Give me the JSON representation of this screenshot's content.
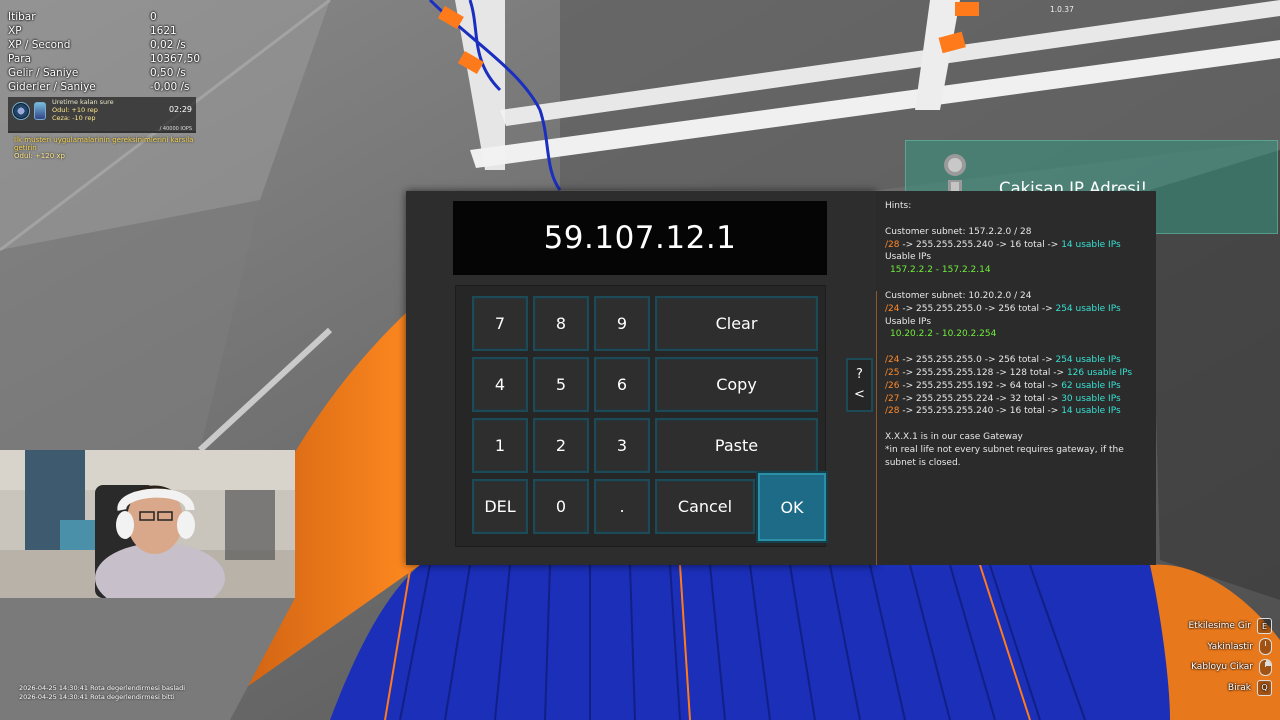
{
  "stats": [
    {
      "label": "Itibar",
      "value": "0"
    },
    {
      "label": "XP",
      "value": "1621"
    },
    {
      "label": "XP / Second",
      "value": "0,02 /s"
    },
    {
      "label": "Para",
      "value": "10367,50"
    },
    {
      "label": "Gelir / Saniye",
      "value": "0,50 /s"
    },
    {
      "label": "Giderler / Saniye",
      "value": "-0,00 /s"
    }
  ],
  "quest": {
    "title": "Uretime kalan sure",
    "reward": "Odul: +10 rep",
    "penalty": "Ceza: -10 rep",
    "timer": "02:29",
    "progress_text": "/ 40000 IOPS",
    "progress_fraction": 0.0
  },
  "customer_task": {
    "text": "Ilk musteri uygulamalarinin gereksinimlerini karsila getirin",
    "reward": "Odul: +120 xp"
  },
  "version": "1.0.37",
  "notification": {
    "title": "Cakisan IP Adresi!",
    "icon": "info-icon"
  },
  "keypad": {
    "display_value": "59.107.12.1",
    "keys": {
      "k7": "7",
      "k8": "8",
      "k9": "9",
      "clear": "Clear",
      "k4": "4",
      "k5": "5",
      "k6": "6",
      "copy": "Copy",
      "k1": "1",
      "k2": "2",
      "k3": "3",
      "paste": "Paste",
      "del": "DEL",
      "k0": "0",
      "dot": ".",
      "cancel": "Cancel",
      "ok": "OK"
    },
    "side_toggle": {
      "help": "?",
      "back": "<"
    }
  },
  "hints": {
    "title": "Hints:",
    "customer1": {
      "subnet": "Customer subnet: 157.2.2.0 / 28",
      "mask": "/28",
      "mask_rest": " -> 255.255.255.240  ->  16 total  -> ",
      "usable": "14 usable IPs",
      "usable_label": "Usable IPs",
      "range": "157.2.2.2 - 157.2.2.14"
    },
    "customer2": {
      "subnet": "Customer subnet: 10.20.2.0 / 24",
      "mask": "/24",
      "mask_rest": " -> 255.255.255.0  ->  256 total  -> ",
      "usable": "254 usable IPs",
      "usable_label": "Usable IPs",
      "range": "10.20.2.2 - 10.20.2.254"
    },
    "table": [
      {
        "mask": "/24",
        "rest": " -> 255.255.255.0  ->  256 total  -> ",
        "usable": "254 usable IPs"
      },
      {
        "mask": "/25",
        "rest": " -> 255.255.255.128  ->  128 total  -> ",
        "usable": "126 usable IPs"
      },
      {
        "mask": "/26",
        "rest": " -> 255.255.255.192  ->  64 total  -> ",
        "usable": "62 usable IPs"
      },
      {
        "mask": "/27",
        "rest": " -> 255.255.255.224  ->  32 total  -> ",
        "usable": "30 usable IPs"
      },
      {
        "mask": "/28",
        "rest": " -> 255.255.255.240  ->  16 total  -> ",
        "usable": "14 usable IPs"
      }
    ],
    "gateway_line": "X.X.X.1 is in our case Gateway",
    "gateway_note": " *in real life not every subnet requires gateway, if the subnet is closed."
  },
  "logs": [
    "2026-04-25 14:30:41 Rota degerlendirmesi basladi",
    "2026-04-25 14:30:41 Rota degerlendirmesi bitti"
  ],
  "controls": [
    {
      "label": "Etkilesime Gir",
      "key": "E",
      "icon": "keycap"
    },
    {
      "label": "Yakinlastir",
      "key": "",
      "icon": "mouse-icon"
    },
    {
      "label": "Kabloyu Cikar",
      "key": "",
      "icon": "mouse-right-icon"
    },
    {
      "label": "Birak",
      "key": "Q",
      "icon": "keycap"
    }
  ],
  "colors": {
    "accent_teal": "#1c4a57",
    "ok_button": "#1e6b88",
    "mask_orange": "#ff8a2a",
    "usable_cyan": "#37e0d2",
    "range_green": "#6fee3a",
    "notification": "#3a9682"
  }
}
